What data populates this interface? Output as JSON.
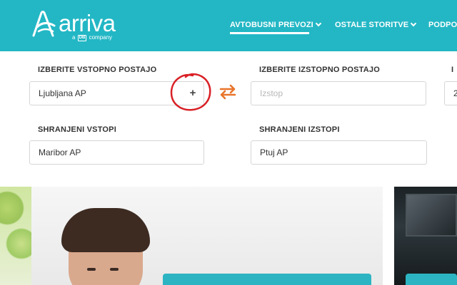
{
  "header": {
    "logo_text": "arriva",
    "logo_sub_prefix": "a",
    "logo_sub_brand": "DB",
    "logo_sub_suffix": "company",
    "nav": [
      {
        "label": "AVTOBUSNI PREVOZI",
        "active": true
      },
      {
        "label": "OSTALE STORITVE",
        "active": false
      },
      {
        "label": "PODPO",
        "active": false
      }
    ],
    "bg_color": "#23b7c5"
  },
  "form": {
    "entry_label": "IZBERITE VSTOPNO POSTAJO",
    "entry_value": "Ljubljana AP",
    "add_symbol": "+",
    "exit_label": "IZBERITE IZSTOPNO POSTAJO",
    "exit_placeholder": "Izstop",
    "date_label_partial": "I",
    "date_value_partial": "2",
    "saved_entries_label": "SHRANJENI VSTOPI",
    "saved_entries_value": "Maribor AP",
    "saved_exits_label": "SHRANJENI IZSTOPI",
    "saved_exits_value": "Ptuj AP",
    "accent_color": "#e8742a",
    "annotation_color": "#d92026"
  },
  "icons": {
    "swap": "swap-arrows-icon",
    "add": "plus-icon",
    "chevron": "chevron-down-icon"
  }
}
